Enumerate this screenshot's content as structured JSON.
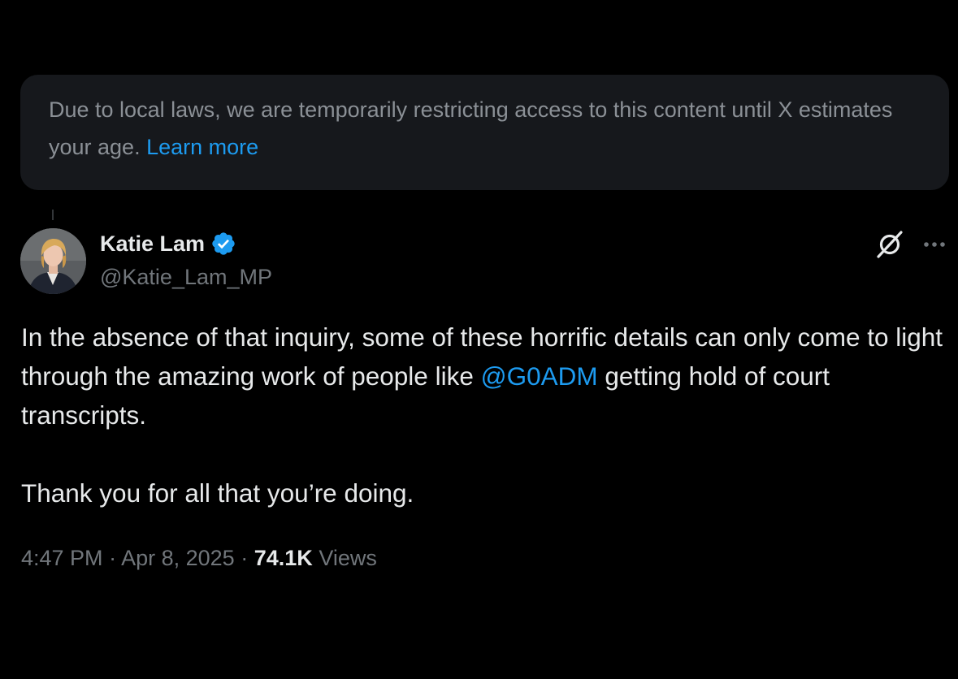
{
  "notice": {
    "text": "Due to local laws, we are temporarily restricting access to this content until X estimates your age.",
    "link_label": "Learn more"
  },
  "tweet": {
    "author_name": "Katie Lam",
    "handle": "@Katie_Lam_MP",
    "paragraph1_before": "In the absence of that inquiry, some of these horrific details can only come to light through the amazing work of people like ",
    "mention": "@G0ADM",
    "paragraph1_after": " getting hold of court transcripts.",
    "paragraph2": "Thank you for all that you’re doing.",
    "time": "4:47 PM",
    "separator": "·",
    "date": "Apr 8, 2025",
    "views_count": "74.1K",
    "views_label": "Views"
  },
  "icons": {
    "verified": "verified-badge-icon",
    "grok": "grok-icon",
    "more": "more-options-icon"
  },
  "colors": {
    "background": "#000000",
    "notice_bg": "#16181c",
    "accent": "#1d9bf0",
    "primary_text": "#e7e9ea",
    "secondary_text": "#71767b"
  }
}
